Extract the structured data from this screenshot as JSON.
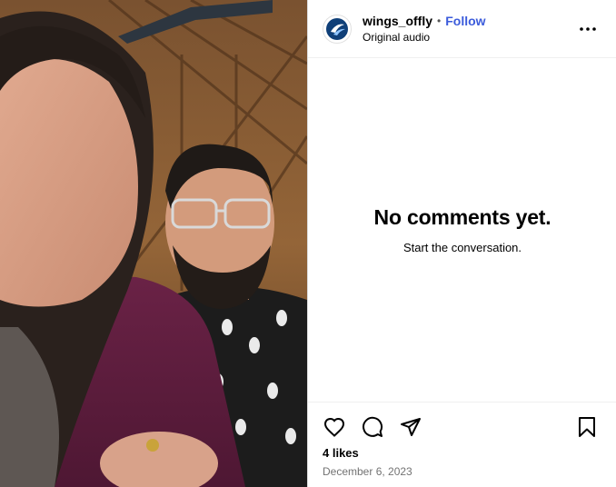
{
  "post": {
    "username": "wings_offly",
    "separator": "•",
    "follow_label": "Follow",
    "audio_label": "Original audio",
    "more_icon": "more-horizontal-icon",
    "avatar_icon": "wings-logo-icon"
  },
  "comments": {
    "empty_title": "No comments yet.",
    "empty_subtitle": "Start the conversation."
  },
  "actions": {
    "icons": [
      "heart-icon",
      "comment-icon",
      "share-icon",
      "bookmark-icon"
    ]
  },
  "stats": {
    "likes": "4 likes",
    "date": "December 6, 2023"
  },
  "colors": {
    "follow": "#3b5bdb",
    "muted": "#737373"
  }
}
